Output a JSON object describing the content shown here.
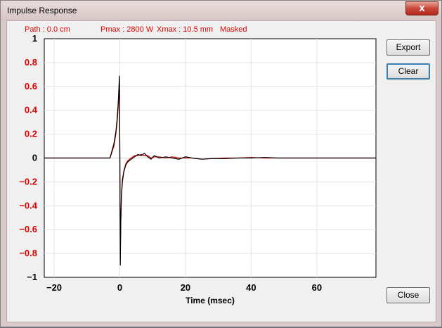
{
  "window": {
    "title": "Impulse Response",
    "close_glyph": "x",
    "close_icon": "close-icon"
  },
  "info": {
    "path": "Path : 0.0 cm",
    "pmax": "Pmax : 2800 W",
    "xmax": "Xmax : 10.5 mm",
    "masked": "Masked"
  },
  "buttons": {
    "export": "Export",
    "clear": "Clear",
    "close": "Close"
  },
  "colors": {
    "info_text": "#e00000",
    "y_tick_text": "#e00000",
    "trace_primary": "#000000",
    "trace_secondary": "#cc0000"
  },
  "chart_data": {
    "type": "line",
    "xlabel": "Time (msec)",
    "ylabel": "",
    "xlim": [
      -23,
      78
    ],
    "ylim": [
      -1,
      1
    ],
    "x_ticks": [
      -20,
      0,
      20,
      40,
      60
    ],
    "x_tick_labels": [
      "−20",
      "0",
      "20",
      "40",
      "60"
    ],
    "y_ticks": [
      1,
      0.8,
      0.6,
      0.4,
      0.2,
      0,
      -0.2,
      -0.4,
      -0.6,
      -0.8,
      -1
    ],
    "y_tick_labels": [
      "1",
      "0.8",
      "0.6",
      "0.4",
      "0.2",
      "0",
      "−0.2",
      "−0.4",
      "−0.6",
      "−0.8",
      "−1"
    ],
    "grid": true,
    "series": [
      {
        "color": "#000000",
        "x": [
          -23,
          -3,
          -2.5,
          -1.8,
          -1.2,
          -0.8,
          -0.5,
          -0.25,
          -0.1,
          0,
          0.15,
          0.3,
          0.5,
          0.8,
          1.2,
          1.8,
          2.5,
          3.5,
          4.5,
          5.5,
          6.5,
          7.5,
          8.5,
          9.5,
          10.5,
          12,
          14,
          16,
          18,
          20,
          22,
          25,
          28,
          32,
          36,
          40,
          44,
          48,
          52,
          56,
          60,
          64,
          68,
          72,
          78
        ],
        "y": [
          0,
          0,
          0.05,
          0.12,
          0.22,
          0.33,
          0.45,
          0.6,
          0.69,
          0.1,
          -0.9,
          -0.55,
          -0.32,
          -0.2,
          -0.12,
          -0.06,
          -0.03,
          -0.01,
          0.01,
          0.03,
          0.02,
          0.04,
          0.01,
          -0.01,
          0.02,
          0.0,
          0.01,
          0.0,
          -0.01,
          0.01,
          0.0,
          -0.01,
          -0.005,
          -0.005,
          0.0,
          0.0,
          0.005,
          0.0,
          0.0,
          0.0,
          0.0,
          0.0,
          0.0,
          0.0,
          0.0
        ]
      },
      {
        "color": "#cc0000",
        "x": [
          -23,
          -3,
          -2.5,
          -1.8,
          -1.2,
          -0.8,
          -0.5,
          -0.25,
          -0.1,
          0,
          0.15,
          0.3,
          0.5,
          0.8,
          1.2,
          1.8,
          2.5,
          3.5,
          4.5,
          5.5,
          6.5,
          7.5,
          8.5,
          9.5,
          10.5,
          12,
          14,
          16,
          18,
          20,
          22,
          25,
          28,
          32,
          36,
          40,
          44,
          48,
          52,
          56,
          60,
          64,
          68,
          72,
          78
        ],
        "y": [
          0,
          0,
          0.04,
          0.1,
          0.2,
          0.3,
          0.42,
          0.55,
          0.62,
          0.05,
          -0.8,
          -0.5,
          -0.3,
          -0.18,
          -0.11,
          -0.05,
          -0.02,
          0.0,
          0.02,
          0.02,
          0.03,
          0.02,
          0.02,
          0.0,
          0.01,
          0.01,
          0.0,
          0.01,
          0.0,
          0.0,
          0.0,
          -0.01,
          -0.005,
          0.0,
          0.0,
          0.005,
          0.0,
          0.0,
          0.0,
          0.0,
          0.0,
          0.0,
          0.0,
          0.0,
          0.0
        ]
      }
    ]
  }
}
